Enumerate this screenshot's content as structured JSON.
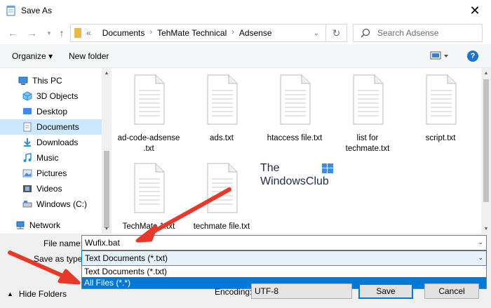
{
  "window": {
    "title": "Save As"
  },
  "address": {
    "prefix": "«",
    "crumbs": [
      "Documents",
      "TehMate Technical",
      "Adsense"
    ],
    "search_placeholder": "Search Adsense"
  },
  "toolbar": {
    "organize_label": "Organize ▾",
    "newfolder_label": "New folder",
    "help_label": "?"
  },
  "nav": {
    "items": [
      {
        "label": "This PC",
        "icon": "computer-icon"
      },
      {
        "label": "3D Objects",
        "icon": "cube-icon"
      },
      {
        "label": "Desktop",
        "icon": "desktop-icon"
      },
      {
        "label": "Documents",
        "icon": "document-icon",
        "selected": true
      },
      {
        "label": "Downloads",
        "icon": "download-icon"
      },
      {
        "label": "Music",
        "icon": "music-icon"
      },
      {
        "label": "Pictures",
        "icon": "picture-icon"
      },
      {
        "label": "Videos",
        "icon": "video-icon"
      },
      {
        "label": "Windows (C:)",
        "icon": "drive-icon"
      },
      {
        "label": "Network",
        "icon": "network-icon"
      }
    ]
  },
  "files": [
    {
      "name": "ad-code-adsense\n.txt"
    },
    {
      "name": "ads.txt"
    },
    {
      "name": "htaccess file.txt"
    },
    {
      "name": "list for\ntechmate.txt"
    },
    {
      "name": "script.txt"
    },
    {
      "name": "TechMate.1.txt"
    },
    {
      "name": "techmate file.txt"
    }
  ],
  "watermark": {
    "line1": "The",
    "line2": "WindowsClub"
  },
  "form": {
    "filename_label": "File name:",
    "filename_value": "Wufix.bat",
    "type_label": "Save as type:",
    "type_value": "Text Documents (*.txt)",
    "type_options": [
      "Text Documents (*.txt)",
      "All Files  (*.*)"
    ],
    "highlighted_option": 1,
    "encoding_label": "Encoding:",
    "encoding_value": "UTF-8",
    "save_label": "Save",
    "cancel_label": "Cancel",
    "hide_folders_label": "Hide Folders"
  },
  "colors": {
    "accent": "#0078d7",
    "selection": "#cce8ff",
    "annotation_arrow": "#e8382a"
  }
}
